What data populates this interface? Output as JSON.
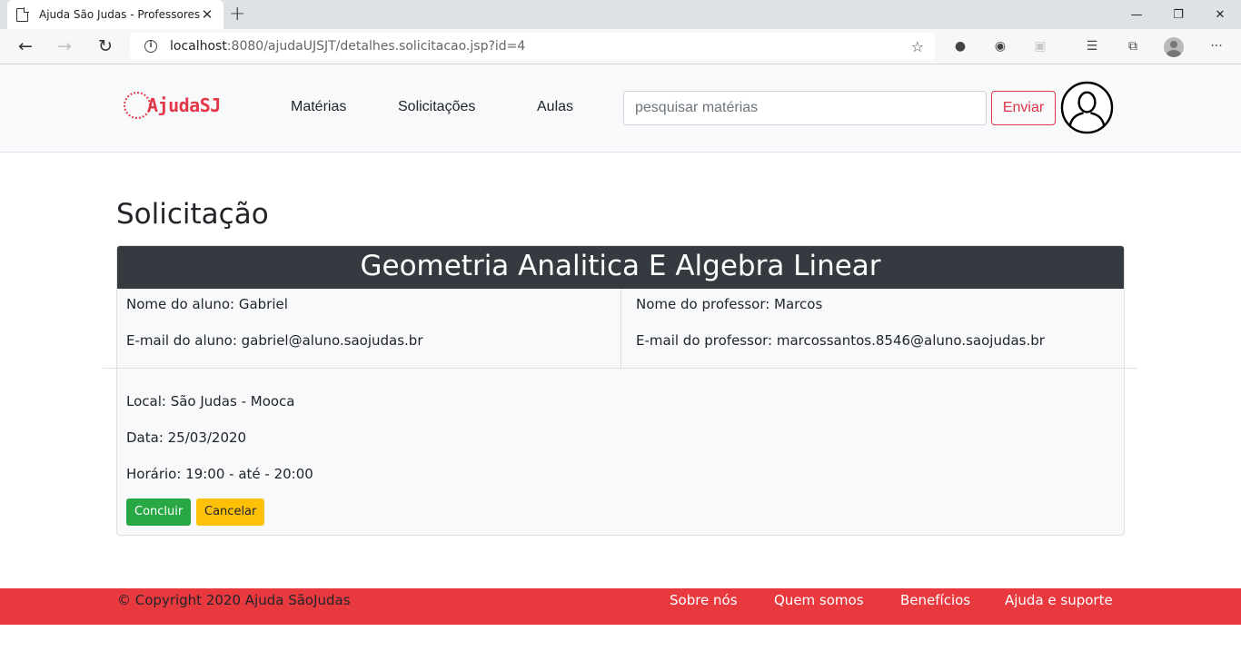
{
  "browser": {
    "tab_title": "Ajuda São Judas - Professores",
    "url_host": "localhost",
    "url_rest": ":8080/ajudaUJSJT/detalhes.solicitacao.jsp?id=4"
  },
  "navbar": {
    "brand": "AjudaSJ",
    "links": [
      "Matérias",
      "Solicitações",
      "Aulas"
    ],
    "search_placeholder": "pesquisar matérias",
    "send_label": "Enviar"
  },
  "main": {
    "page_title": "Solicitação",
    "subject": "Geometria Analitica E Algebra Linear",
    "student_name": "Nome do aluno: Gabriel",
    "student_email": "E-mail do aluno: gabriel@aluno.saojudas.br",
    "teacher_name": "Nome do professor: Marcos",
    "teacher_email": "E-mail do professor: marcossantos.8546@aluno.saojudas.br",
    "location": "Local: São Judas - Mooca",
    "date": "Data: 25/03/2020",
    "time": "Horário: 19:00 - até - 20:00",
    "conclude_label": "Concluir",
    "cancel_label": "Cancelar"
  },
  "footer": {
    "copyright": "© Copyright 2020 Ajuda SãoJudas",
    "links": [
      "Sobre nós",
      "Quem somos",
      "Benefícios",
      "Ajuda e suporte"
    ]
  },
  "colors": {
    "brand": "#e3384a",
    "footer": "#e8393f",
    "header_dark": "#343a40",
    "success": "#28a745",
    "warning": "#ffc107",
    "danger": "#dc3545"
  }
}
